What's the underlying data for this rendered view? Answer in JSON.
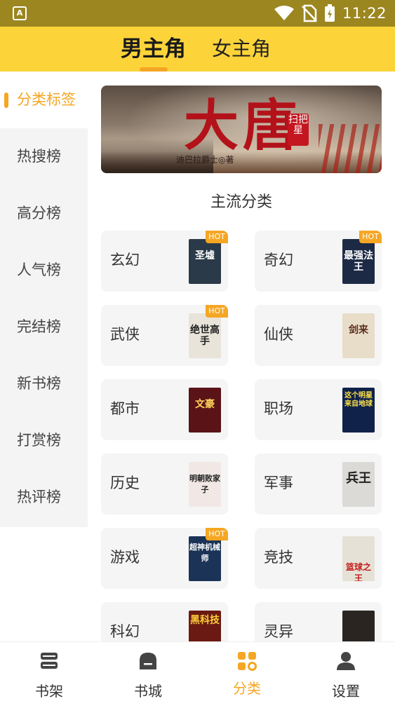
{
  "status_bar": {
    "app_badge": "A",
    "time": "11:22",
    "icons": [
      "wifi-icon",
      "no-sim-icon",
      "battery-charging-icon"
    ]
  },
  "top_tabs": [
    {
      "label": "男主角",
      "active": true
    },
    {
      "label": "女主角",
      "active": false
    }
  ],
  "sidebar": {
    "items": [
      {
        "label": "分类标签",
        "active": true
      },
      {
        "label": "热搜榜",
        "active": false
      },
      {
        "label": "高分榜",
        "active": false
      },
      {
        "label": "人气榜",
        "active": false
      },
      {
        "label": "完结榜",
        "active": false
      },
      {
        "label": "新书榜",
        "active": false
      },
      {
        "label": "打赏榜",
        "active": false
      },
      {
        "label": "热评榜",
        "active": false
      }
    ]
  },
  "banner": {
    "title": "大唐",
    "seal": "扫把星",
    "author": "迪巴拉爵士◎著"
  },
  "section_title": "主流分类",
  "hot_label": "HOT",
  "categories": [
    {
      "name": "玄幻",
      "hot": true,
      "cover_text": "圣墟",
      "cover_color": "#2b3a48"
    },
    {
      "name": "奇幻",
      "hot": true,
      "cover_text": "最强法王",
      "cover_color": "#1d2a45"
    },
    {
      "name": "武侠",
      "hot": true,
      "cover_text": "绝世高手",
      "cover_color": "#e9e4da"
    },
    {
      "name": "仙侠",
      "hot": false,
      "cover_text": "剑来",
      "cover_color": "#e8ddc8"
    },
    {
      "name": "都市",
      "hot": false,
      "cover_text": "文豪",
      "cover_color": "#5a1418"
    },
    {
      "name": "职场",
      "hot": false,
      "cover_text": "这个明星来自地球",
      "cover_color": "#10224a"
    },
    {
      "name": "历史",
      "hot": false,
      "cover_text": "明朝败家子",
      "cover_color": "#f1e8e6"
    },
    {
      "name": "军事",
      "hot": false,
      "cover_text": "兵王",
      "cover_color": "#dcdad6"
    },
    {
      "name": "游戏",
      "hot": true,
      "cover_text": "超神机械师",
      "cover_color": "#1a3356"
    },
    {
      "name": "竞技",
      "hot": false,
      "cover_text": "篮球之王",
      "cover_color": "#e6e1d6"
    },
    {
      "name": "科幻",
      "hot": false,
      "cover_text": "黑科技",
      "cover_color": "#6a1a12"
    },
    {
      "name": "灵异",
      "hot": false,
      "cover_text": "",
      "cover_color": "#2a2520"
    }
  ],
  "bottom_nav": [
    {
      "label": "书架",
      "icon": "bookshelf-icon",
      "active": false
    },
    {
      "label": "书城",
      "icon": "bookstore-icon",
      "active": false
    },
    {
      "label": "分类",
      "icon": "category-grid-icon",
      "active": true
    },
    {
      "label": "设置",
      "icon": "user-settings-icon",
      "active": false
    }
  ],
  "colors": {
    "accent": "#f5a623",
    "header_yellow": "#fcd43a",
    "status_bar": "#9c861f"
  }
}
